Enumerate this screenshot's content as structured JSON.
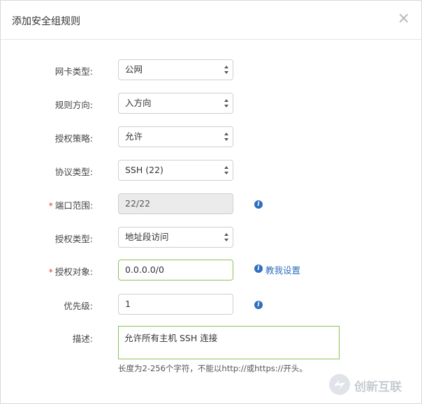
{
  "dialog": {
    "title": "添加安全组规则",
    "close_glyph": "×"
  },
  "form": {
    "nic_type": {
      "label": "网卡类型:",
      "value": "公网"
    },
    "direction": {
      "label": "规则方向:",
      "value": "入方向"
    },
    "policy": {
      "label": "授权策略:",
      "value": "允许"
    },
    "protocol": {
      "label": "协议类型:",
      "value": "SSH (22)"
    },
    "port_range": {
      "label": "端口范围:",
      "required": "*",
      "value": "22/22",
      "info_icon": "info-icon"
    },
    "auth_type": {
      "label": "授权类型:",
      "value": "地址段访问"
    },
    "auth_object": {
      "label": "授权对象:",
      "required": "*",
      "value": "0.0.0.0/0",
      "help_link": "教我设置"
    },
    "priority": {
      "label": "优先级:",
      "value": "1"
    },
    "description": {
      "label": "描述:",
      "value": "允许所有主机 SSH 连接",
      "hint": "长度为2-256个字符，不能以http://或https://开头。"
    }
  },
  "watermark": {
    "text": "创新互联"
  },
  "colors": {
    "link": "#2f6fbd",
    "required": "#e4393c",
    "focus_border": "#8cc152"
  }
}
